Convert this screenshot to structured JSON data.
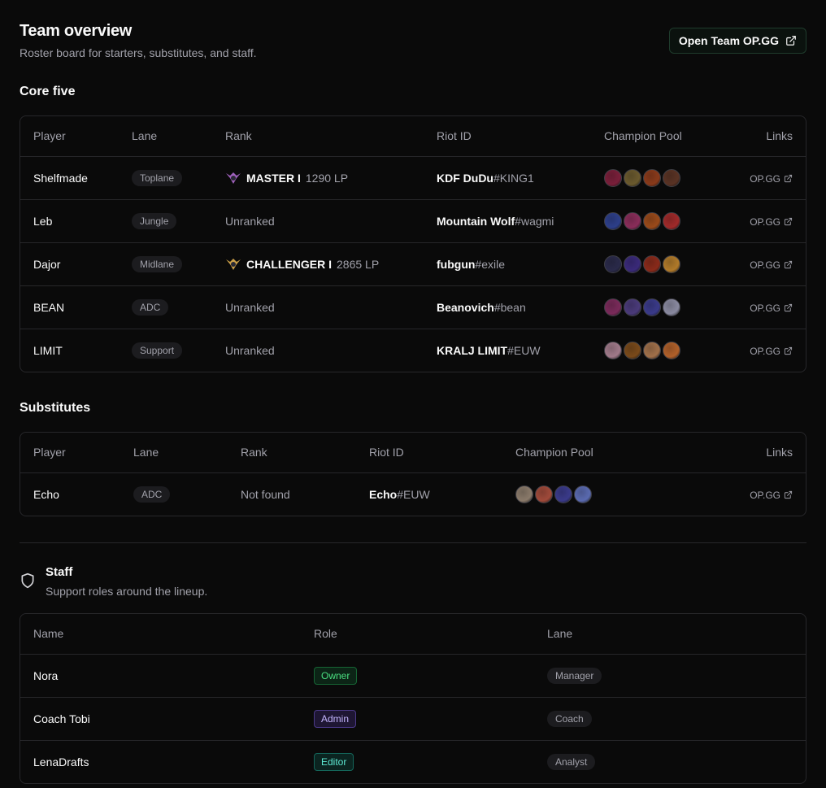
{
  "header": {
    "title": "Team overview",
    "subtitle": "Roster board for starters, substitutes, and staff.",
    "open_button": "Open Team OP.GG"
  },
  "core": {
    "title": "Core five",
    "columns": [
      "Player",
      "Lane",
      "Rank",
      "Riot ID",
      "Champion Pool",
      "Links"
    ],
    "rows": [
      {
        "player": "Shelfmade",
        "lane": "Toplane",
        "rank_tier": "MASTER I",
        "rank_lp": "1290 LP",
        "unranked": "",
        "riot_name": "KDF DuDu",
        "riot_tag": "#KING1",
        "link": "OP.GG",
        "champs": [
          "#7a1f3a",
          "#6b5a2e",
          "#8a3a1a",
          "#5a3324"
        ],
        "emblem": "#b06ad0"
      },
      {
        "player": "Leb",
        "lane": "Jungle",
        "rank_tier": "",
        "rank_lp": "",
        "unranked": "Unranked",
        "riot_name": "Mountain Wolf",
        "riot_tag": "#wagmi",
        "link": "OP.GG",
        "champs": [
          "#2d3f8a",
          "#8a2d5a",
          "#9a4a1a",
          "#a02a2a"
        ],
        "emblem": ""
      },
      {
        "player": "Dajor",
        "lane": "Midlane",
        "rank_tier": "CHALLENGER I",
        "rank_lp": "2865 LP",
        "unranked": "",
        "riot_name": "fubgun",
        "riot_tag": "#exile",
        "link": "OP.GG",
        "champs": [
          "#2a2a4a",
          "#3a2a7a",
          "#8a2a1a",
          "#b07a2a"
        ],
        "emblem": "#e0b050"
      },
      {
        "player": "BEAN",
        "lane": "ADC",
        "rank_tier": "",
        "rank_lp": "",
        "unranked": "Unranked",
        "riot_name": "Beanovich",
        "riot_tag": "#bean",
        "link": "OP.GG",
        "champs": [
          "#7a2a5a",
          "#4a3a7a",
          "#3a3a8a",
          "#8a8aa0"
        ],
        "emblem": ""
      },
      {
        "player": "LIMIT",
        "lane": "Support",
        "rank_tier": "",
        "rank_lp": "",
        "unranked": "Unranked",
        "riot_name": "KRALJ LIMIT",
        "riot_tag": "#EUW",
        "link": "OP.GG",
        "champs": [
          "#a07a8a",
          "#7a4a1a",
          "#a0704a",
          "#b0602a"
        ],
        "emblem": ""
      }
    ]
  },
  "subs": {
    "title": "Substitutes",
    "columns": [
      "Player",
      "Lane",
      "Rank",
      "Riot ID",
      "Champion Pool",
      "Links"
    ],
    "rows": [
      {
        "player": "Echo",
        "lane": "ADC",
        "rank": "Not found",
        "riot_name": "Echo",
        "riot_tag": "#EUW",
        "link": "OP.GG",
        "champs": [
          "#8a7a6a",
          "#a04a3a",
          "#3a3a8a",
          "#5a6ab0"
        ]
      }
    ]
  },
  "staff": {
    "title": "Staff",
    "subtitle": "Support roles around the lineup.",
    "columns": [
      "Name",
      "Role",
      "Lane"
    ],
    "rows": [
      {
        "name": "Nora",
        "role": "Owner",
        "lane": "Manager",
        "role_color": "#4ade80",
        "role_bg": "#0c2416",
        "role_border": "#166534"
      },
      {
        "name": "Coach Tobi",
        "role": "Admin",
        "lane": "Coach",
        "role_color": "#c4b5fd",
        "role_bg": "#1e1633",
        "role_border": "#4c3a8a"
      },
      {
        "name": "LenaDrafts",
        "role": "Editor",
        "lane": "Analyst",
        "role_color": "#5eead4",
        "role_bg": "#0b2420",
        "role_border": "#14665a"
      }
    ]
  }
}
